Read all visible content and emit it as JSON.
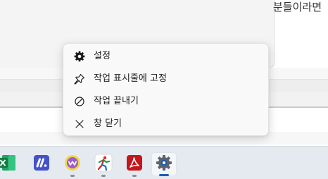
{
  "background": {
    "document_text": "분들이라면"
  },
  "context_menu": {
    "items": [
      {
        "label": "설정",
        "icon": "gear-icon"
      },
      {
        "label": "작업 표시줄에 고정",
        "icon": "pin-icon"
      },
      {
        "label": "작업 끝내기",
        "icon": "end-task-icon"
      },
      {
        "label": "창 닫기",
        "icon": "close-icon"
      }
    ]
  },
  "taskbar": {
    "apps": [
      {
        "name": "excel-icon",
        "color": "#107c41",
        "active": false
      },
      {
        "name": "monday-icon",
        "color": "#4453c9",
        "active": false
      },
      {
        "name": "wave-app-icon",
        "color": "#e8c93a",
        "active": false
      },
      {
        "name": "runner-app-icon",
        "color": "#d62b2b",
        "active": false
      },
      {
        "name": "acrobat-icon",
        "color": "#c4161c",
        "active": false
      },
      {
        "name": "settings-gear-icon",
        "color": "#5c6470",
        "active": true
      }
    ]
  },
  "colors": {
    "accent": "#1a5fb4",
    "menu_bg": "#f9f9f9"
  }
}
